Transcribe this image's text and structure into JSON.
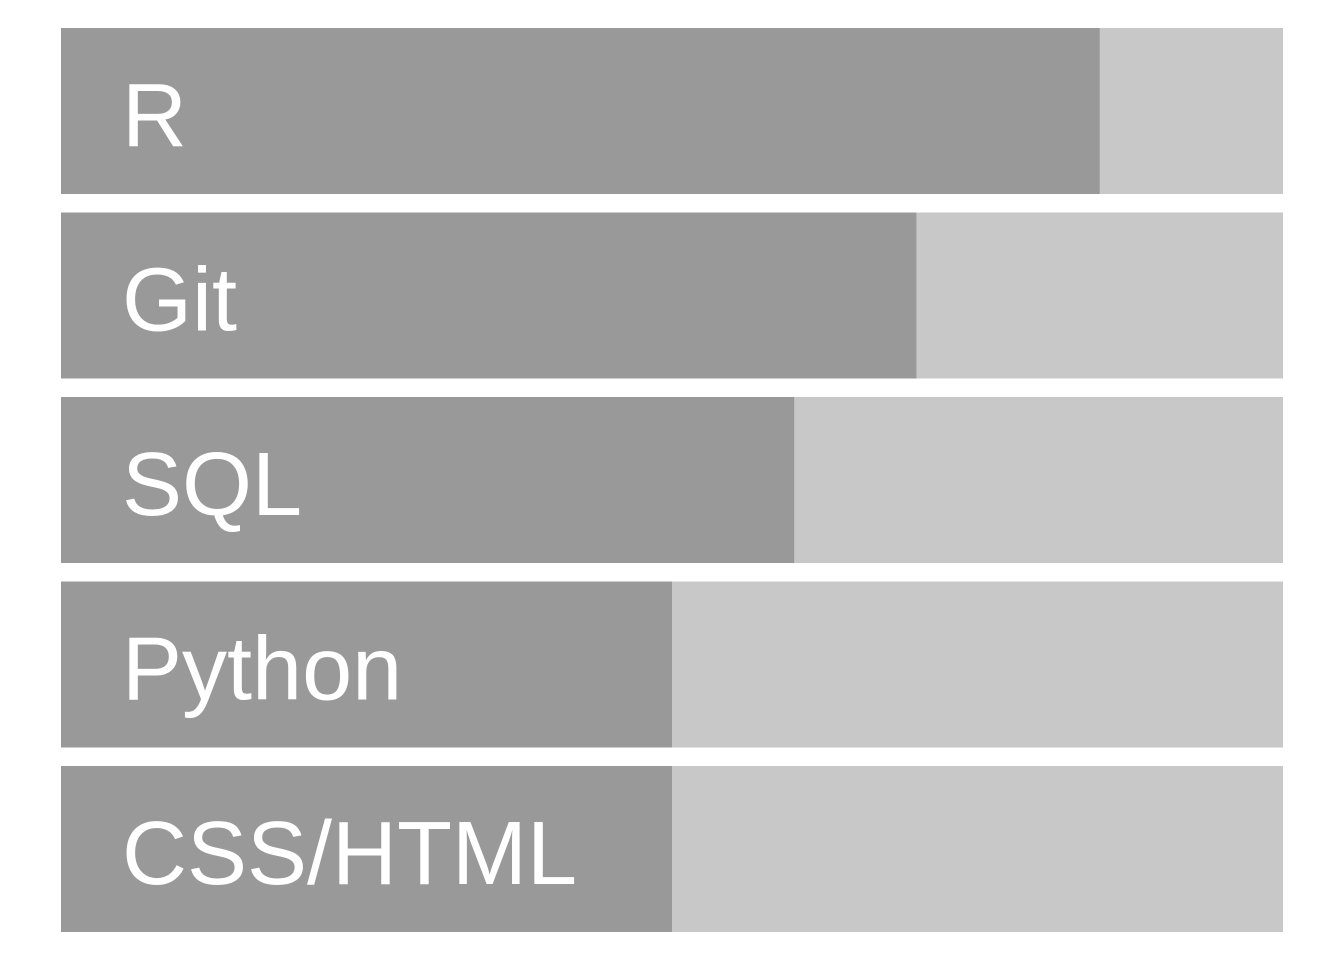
{
  "chart_data": {
    "type": "bar",
    "orientation": "horizontal",
    "categories": [
      "R",
      "Git",
      "SQL",
      "Python",
      "CSS/HTML"
    ],
    "values": [
      0.85,
      0.7,
      0.6,
      0.5,
      0.5
    ],
    "xlim": [
      0,
      1
    ],
    "title": "",
    "xlabel": "",
    "ylabel": "",
    "grid": false,
    "legend": "none"
  },
  "colors": {
    "fill": "#999999",
    "track": "#c8c8c8",
    "label": "#ffffff",
    "background": "#ffffff"
  }
}
